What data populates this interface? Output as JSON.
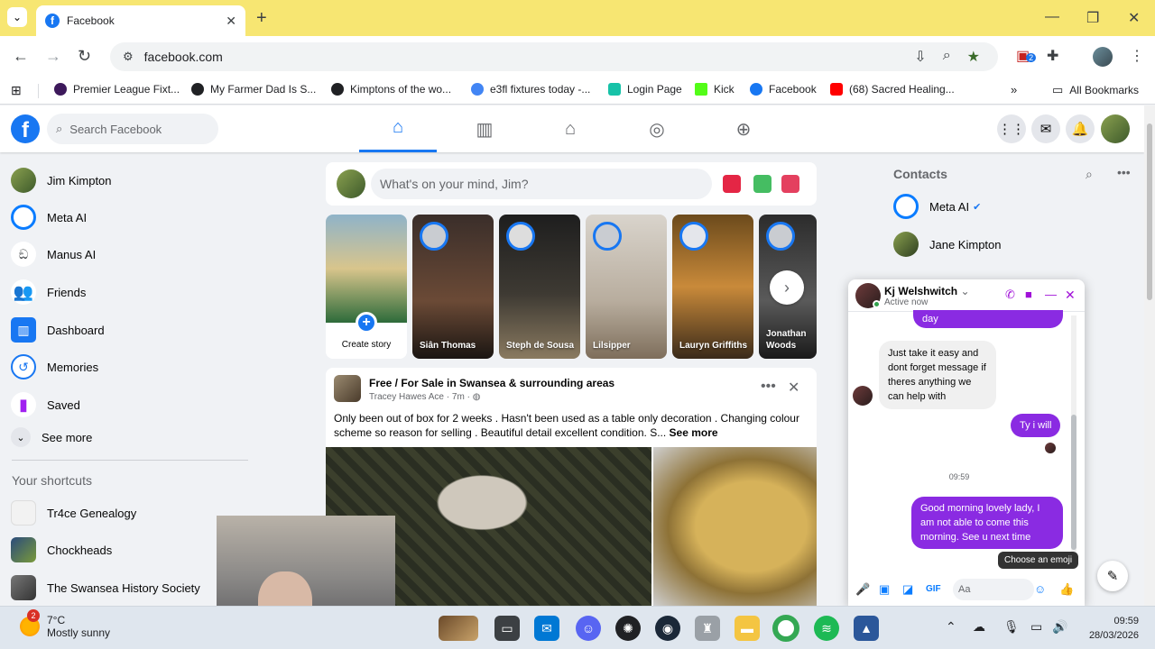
{
  "browser": {
    "tab_title": "Facebook",
    "url": "facebook.com",
    "extension_badge": "2",
    "bookmarks": [
      {
        "label": "Premier League Fixt...",
        "color": "#3d195b"
      },
      {
        "label": "My Farmer Dad Is S...",
        "color": "#202124"
      },
      {
        "label": "Kimptons of the wo...",
        "color": "#202124"
      },
      {
        "label": "e3fl fixtures today -...",
        "color": "#4285f4"
      },
      {
        "label": "Login Page",
        "color": "#17c2a8"
      },
      {
        "label": "Kick",
        "color": "#53fc18"
      },
      {
        "label": "Facebook",
        "color": "#1877f2"
      },
      {
        "label": "(68) Sacred Healing...",
        "color": "#ff0000"
      }
    ],
    "all_bookmarks": "All Bookmarks"
  },
  "fb": {
    "search_placeholder": "Search Facebook",
    "left_nav": [
      {
        "label": "Jim Kimpton",
        "icon": "profile-avatar",
        "color": "#5b7b3a"
      },
      {
        "label": "Meta AI",
        "icon": "meta-ai-icon",
        "color": "#0a7cff"
      },
      {
        "label": "Manus AI",
        "icon": "manus-ai-icon",
        "color": "#9aa0a6"
      },
      {
        "label": "Friends",
        "icon": "friends-icon",
        "color": "#1877f2"
      },
      {
        "label": "Dashboard",
        "icon": "dashboard-icon",
        "color": "#1877f2"
      },
      {
        "label": "Memories",
        "icon": "memories-icon",
        "color": "#1877f2"
      },
      {
        "label": "Saved",
        "icon": "saved-icon",
        "color": "#a020f0"
      },
      {
        "label": "See more",
        "icon": "chevron-down-icon",
        "color": "#e4e6eb"
      }
    ],
    "shortcuts_title": "Your shortcuts",
    "shortcuts": [
      {
        "label": "Tr4ce Genealogy"
      },
      {
        "label": "Chockheads"
      },
      {
        "label": "The Swansea History Society"
      }
    ],
    "composer_placeholder": "What's on your mind, Jim?",
    "stories": [
      {
        "label": "Create story"
      },
      {
        "label": "Siân Thomas"
      },
      {
        "label": "Steph de Sousa"
      },
      {
        "label": "Lilsipper"
      },
      {
        "label": "Lauryn Griffiths"
      },
      {
        "label": "Jonathan Woods"
      }
    ],
    "post": {
      "group": "Free / For Sale in Swansea & surrounding areas",
      "author": "Tracey Hawes Ace",
      "time": "7m",
      "text": "Only been out of box for 2 weeks . Hasn't been used as a table only decoration . Changing colour scheme so reason for selling . Beautiful detail excellent condition.  S...",
      "see_more": "See more"
    },
    "contacts_title": "Contacts",
    "contacts": [
      {
        "label": "Meta AI"
      },
      {
        "label": "Jane Kimpton"
      }
    ],
    "chat": {
      "name": "Kj Welshwitch",
      "status": "Active now",
      "msg_top": "day",
      "msg_in": "Just take it easy  and dont forget message if theres anything we can help with",
      "msg_out1": "Ty i will",
      "time": "09:59",
      "msg_out2": "Good morning lovely lady, I am not able to come this morning. See u next time",
      "tooltip": "Choose an emoji",
      "input_placeholder": "Aa"
    }
  },
  "taskbar": {
    "weather_badge": "2",
    "temp": "7°C",
    "condition": "Mostly sunny",
    "time": "09:59",
    "date": "28/03/2026"
  }
}
